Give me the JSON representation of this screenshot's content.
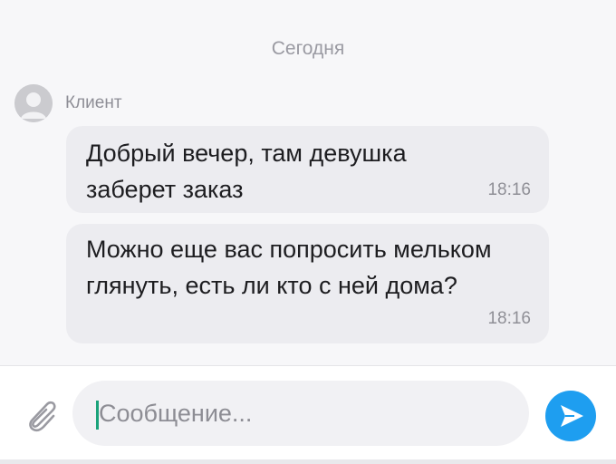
{
  "chat": {
    "date_separator": "Сегодня",
    "sender_name": "Клиент",
    "messages": [
      {
        "text": "Добрый вечер, там девушка заберет заказ",
        "time": "18:16"
      },
      {
        "text": "Можно еще вас попросить мельком глянуть, есть ли кто с ней дома?",
        "time": "18:16"
      }
    ]
  },
  "composer": {
    "placeholder": "Сообщение...",
    "attach_icon": "paperclip-icon",
    "send_icon": "send-arrow-icon"
  },
  "colors": {
    "background": "#f7f7f9",
    "bubble": "#ececf0",
    "send_button": "#1e9ef0",
    "caret": "#1aa37a"
  }
}
